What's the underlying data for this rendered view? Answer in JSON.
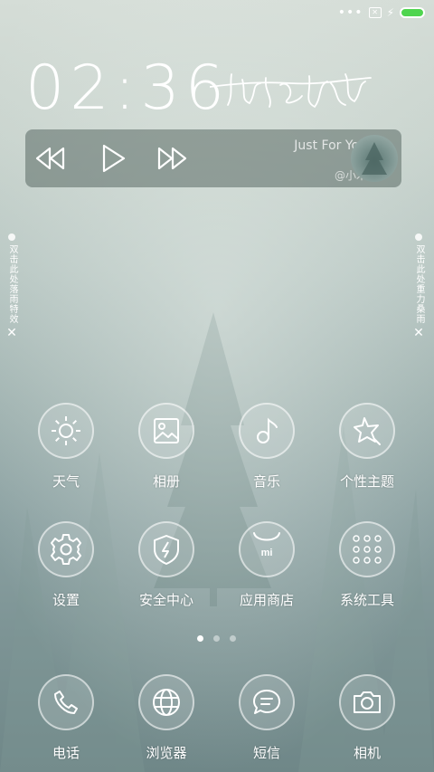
{
  "status_bar": {
    "more_icon": "dots-icon",
    "sim_icon": "sim-icon",
    "charging_icon": "charging-icon",
    "battery_color": "#4fd54f"
  },
  "clock": {
    "time": "02:36"
  },
  "music": {
    "song": "Just For You",
    "artist": "@小木",
    "controls": [
      "rewind-icon",
      "play-icon",
      "fast-forward-icon"
    ]
  },
  "side_left": {
    "text": "双击此处落雨特效"
  },
  "side_right": {
    "text": "双击此处重力桑雨"
  },
  "apps": [
    {
      "label": "天气",
      "icon": "sun-icon"
    },
    {
      "label": "相册",
      "icon": "gallery-icon"
    },
    {
      "label": "音乐",
      "icon": "music-note-icon"
    },
    {
      "label": "个性主题",
      "icon": "theme-star-icon"
    },
    {
      "label": "设置",
      "icon": "gear-icon"
    },
    {
      "label": "安全中心",
      "icon": "shield-icon"
    },
    {
      "label": "应用商店",
      "icon": "store-bag-icon"
    },
    {
      "label": "系统工具",
      "icon": "tools-grid-icon"
    }
  ],
  "pager": {
    "pages": 3,
    "current": 1
  },
  "dock": [
    {
      "label": "电话",
      "icon": "phone-icon"
    },
    {
      "label": "浏览器",
      "icon": "globe-icon"
    },
    {
      "label": "短信",
      "icon": "chat-bubble-icon"
    },
    {
      "label": "相机",
      "icon": "camera-icon"
    }
  ]
}
